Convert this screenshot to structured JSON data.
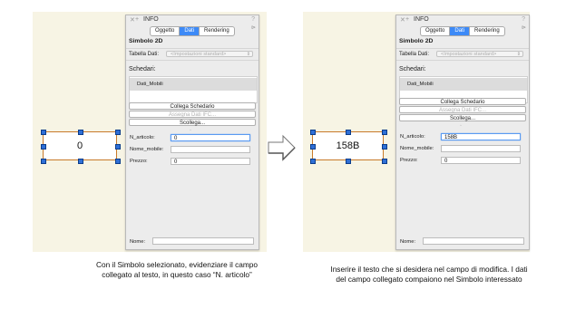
{
  "panel": {
    "title": "INFO",
    "close_icon": "✕",
    "plus_icon": "+",
    "pin_icon": "?",
    "menu_icon": "⊳",
    "tabs": [
      "Oggetto",
      "Dati",
      "Rendering"
    ],
    "active_tab": "Dati",
    "section_title": "Simbolo 2D",
    "tabella_label": "Tabella Dati:",
    "tabella_value": "<Impostazioni standard>",
    "schedari_title": "Schedari:",
    "schedari_items": [
      "Dati_Mobili"
    ],
    "buttons": {
      "collega": "Collega Schedario",
      "assegna": "Assegna Dati IFC...",
      "scollega": "Scollega..."
    },
    "fields": {
      "n_articolo_label": "N_articolo:",
      "nome_mobile_label": "Nome_mobile:",
      "prezzo_label": "Prezzo:",
      "prezzo_value": "0"
    },
    "name_label": "Nome:"
  },
  "left": {
    "symbol_text": "0",
    "n_articolo_value": "0",
    "caption": "Con il Simbolo selezionato, evidenziare il campo collegato al testo, in questo caso “N. articolo”"
  },
  "right": {
    "symbol_text": "158B",
    "n_articolo_value": "158B",
    "caption": "Inserire il testo che si desidera nel campo di modifica. I dati del campo collegato compaiono nel Simbolo interessato"
  },
  "colors": {
    "accent": "#3d8af7",
    "symbol_border": "#c87a2a",
    "handle": "#2f6fd6",
    "canvas": "#f7f4e4"
  }
}
